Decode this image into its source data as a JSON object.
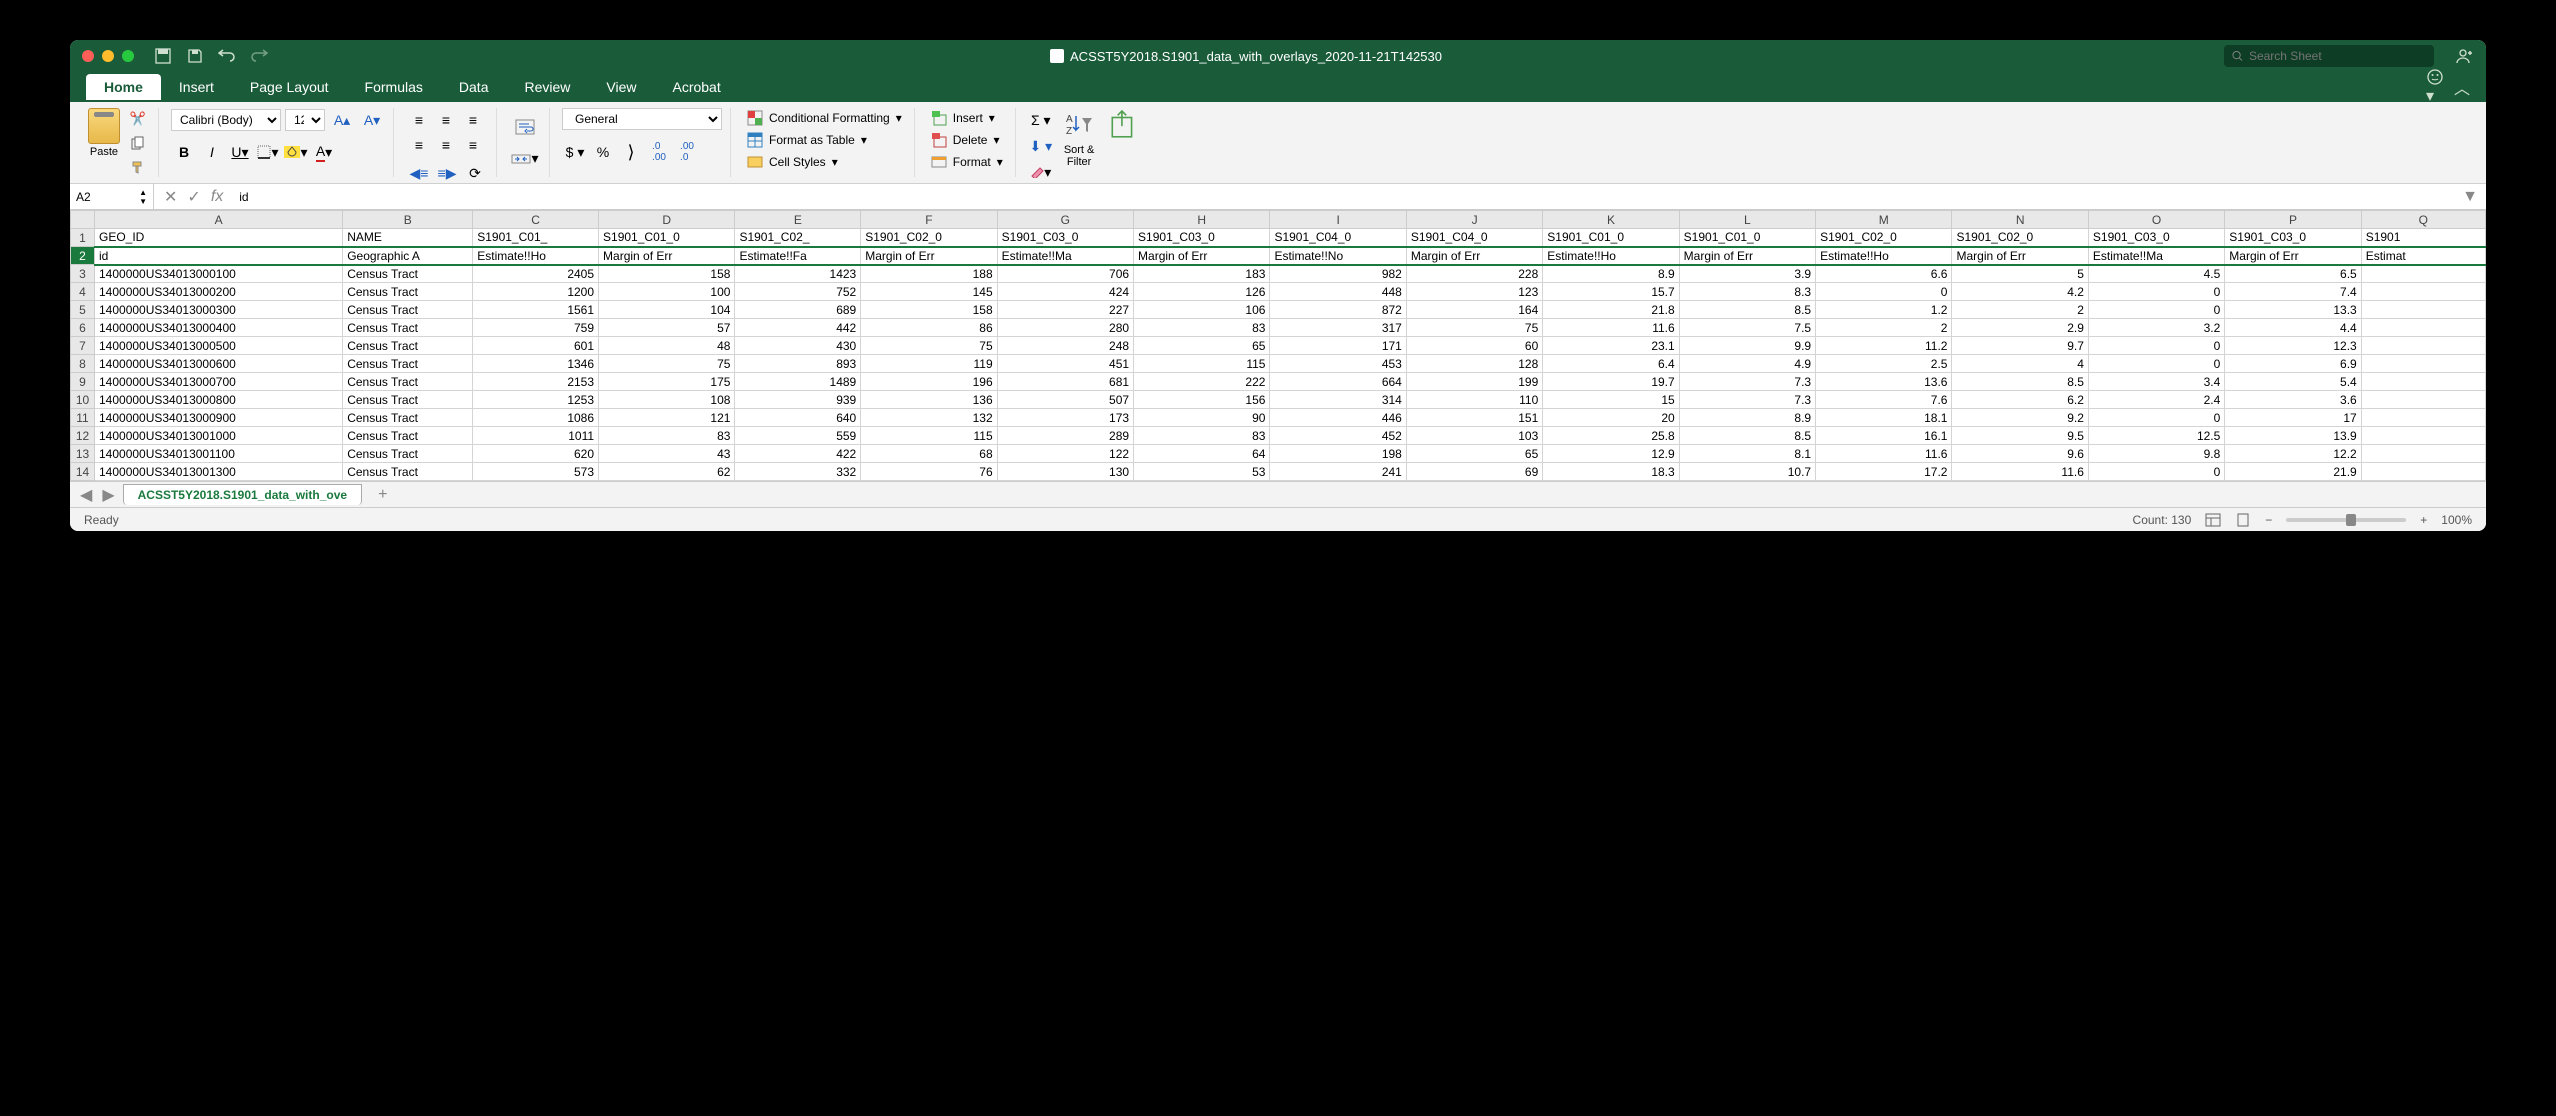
{
  "title": "ACSST5Y2018.S1901_data_with_overlays_2020-11-21T142530",
  "search_placeholder": "Search Sheet",
  "tabs": [
    "Home",
    "Insert",
    "Page Layout",
    "Formulas",
    "Data",
    "Review",
    "View",
    "Acrobat"
  ],
  "active_tab": "Home",
  "clipboard": {
    "paste": "Paste"
  },
  "font": {
    "name": "Calibri (Body)",
    "size": "12",
    "bold": "B",
    "italic": "I",
    "underline": "U"
  },
  "number_format": "General",
  "styles": {
    "cond": "Conditional Formatting",
    "table": "Format as Table",
    "cell": "Cell Styles"
  },
  "cells": {
    "insert": "Insert",
    "delete": "Delete",
    "format": "Format"
  },
  "editing": {
    "sort": "Sort &\nFilter"
  },
  "name_box": "A2",
  "formula": "id",
  "columns": [
    "A",
    "B",
    "C",
    "D",
    "E",
    "F",
    "G",
    "H",
    "I",
    "J",
    "K",
    "L",
    "M",
    "N",
    "O",
    "P",
    "Q"
  ],
  "col_widths": {
    "A": 156,
    "B": 80
  },
  "rows": [
    {
      "n": 1,
      "cells": [
        "GEO_ID",
        "NAME",
        "S1901_C01_",
        "S1901_C01_0",
        "S1901_C02_",
        "S1901_C02_0",
        "S1901_C03_0",
        "S1901_C03_0",
        "S1901_C04_0",
        "S1901_C04_0",
        "S1901_C01_0",
        "S1901_C01_0",
        "S1901_C02_0",
        "S1901_C02_0",
        "S1901_C03_0",
        "S1901_C03_0",
        "S1901"
      ]
    },
    {
      "n": 2,
      "active": true,
      "cells": [
        "id",
        "Geographic A",
        "Estimate!!Ho",
        "Margin of Err",
        "Estimate!!Fa",
        "Margin of Err",
        "Estimate!!Ma",
        "Margin of Err",
        "Estimate!!No",
        "Margin of Err",
        "Estimate!!Ho",
        "Margin of Err",
        "Estimate!!Ho",
        "Margin of Err",
        "Estimate!!Ma",
        "Margin of Err",
        "Estimat"
      ]
    },
    {
      "n": 3,
      "cells": [
        "1400000US34013000100",
        "Census Tract",
        "2405",
        "158",
        "1423",
        "188",
        "706",
        "183",
        "982",
        "228",
        "8.9",
        "3.9",
        "6.6",
        "5",
        "4.5",
        "6.5",
        ""
      ]
    },
    {
      "n": 4,
      "cells": [
        "1400000US34013000200",
        "Census Tract",
        "1200",
        "100",
        "752",
        "145",
        "424",
        "126",
        "448",
        "123",
        "15.7",
        "8.3",
        "0",
        "4.2",
        "0",
        "7.4",
        ""
      ]
    },
    {
      "n": 5,
      "cells": [
        "1400000US34013000300",
        "Census Tract",
        "1561",
        "104",
        "689",
        "158",
        "227",
        "106",
        "872",
        "164",
        "21.8",
        "8.5",
        "1.2",
        "2",
        "0",
        "13.3",
        ""
      ]
    },
    {
      "n": 6,
      "cells": [
        "1400000US34013000400",
        "Census Tract",
        "759",
        "57",
        "442",
        "86",
        "280",
        "83",
        "317",
        "75",
        "11.6",
        "7.5",
        "2",
        "2.9",
        "3.2",
        "4.4",
        ""
      ]
    },
    {
      "n": 7,
      "cells": [
        "1400000US34013000500",
        "Census Tract",
        "601",
        "48",
        "430",
        "75",
        "248",
        "65",
        "171",
        "60",
        "23.1",
        "9.9",
        "11.2",
        "9.7",
        "0",
        "12.3",
        ""
      ]
    },
    {
      "n": 8,
      "cells": [
        "1400000US34013000600",
        "Census Tract",
        "1346",
        "75",
        "893",
        "119",
        "451",
        "115",
        "453",
        "128",
        "6.4",
        "4.9",
        "2.5",
        "4",
        "0",
        "6.9",
        ""
      ]
    },
    {
      "n": 9,
      "cells": [
        "1400000US34013000700",
        "Census Tract",
        "2153",
        "175",
        "1489",
        "196",
        "681",
        "222",
        "664",
        "199",
        "19.7",
        "7.3",
        "13.6",
        "8.5",
        "3.4",
        "5.4",
        ""
      ]
    },
    {
      "n": 10,
      "cells": [
        "1400000US34013000800",
        "Census Tract",
        "1253",
        "108",
        "939",
        "136",
        "507",
        "156",
        "314",
        "110",
        "15",
        "7.3",
        "7.6",
        "6.2",
        "2.4",
        "3.6",
        ""
      ]
    },
    {
      "n": 11,
      "cells": [
        "1400000US34013000900",
        "Census Tract",
        "1086",
        "121",
        "640",
        "132",
        "173",
        "90",
        "446",
        "151",
        "20",
        "8.9",
        "18.1",
        "9.2",
        "0",
        "17",
        ""
      ]
    },
    {
      "n": 12,
      "cells": [
        "1400000US34013001000",
        "Census Tract",
        "1011",
        "83",
        "559",
        "115",
        "289",
        "83",
        "452",
        "103",
        "25.8",
        "8.5",
        "16.1",
        "9.5",
        "12.5",
        "13.9",
        ""
      ]
    },
    {
      "n": 13,
      "cells": [
        "1400000US34013001100",
        "Census Tract",
        "620",
        "43",
        "422",
        "68",
        "122",
        "64",
        "198",
        "65",
        "12.9",
        "8.1",
        "11.6",
        "9.6",
        "9.8",
        "12.2",
        ""
      ]
    },
    {
      "n": 14,
      "cells": [
        "1400000US34013001300",
        "Census Tract",
        "573",
        "62",
        "332",
        "76",
        "130",
        "53",
        "241",
        "69",
        "18.3",
        "10.7",
        "17.2",
        "11.6",
        "0",
        "21.9",
        ""
      ]
    }
  ],
  "sheet_tab": "ACSST5Y2018.S1901_data_with_ove",
  "status": {
    "ready": "Ready",
    "count": "Count: 130",
    "zoom": "100%"
  }
}
